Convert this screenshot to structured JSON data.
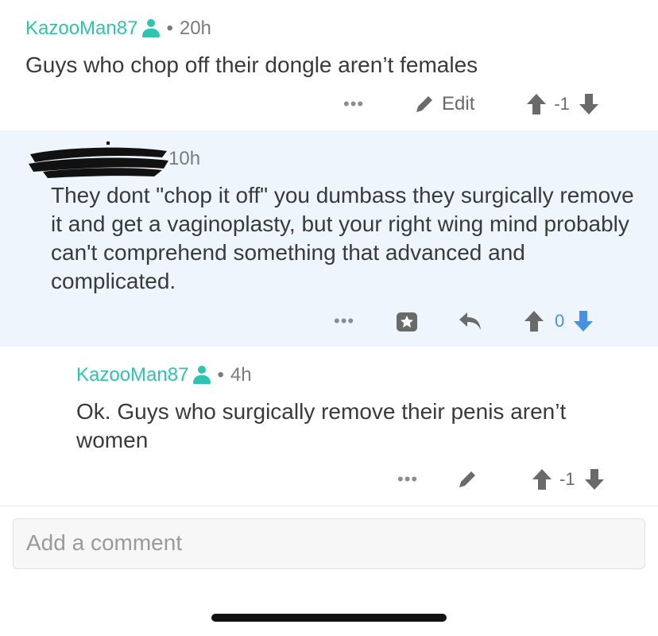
{
  "comments": [
    {
      "username": "KazooMan87",
      "time": "20h",
      "text": "Guys who chop off their dongle aren’t females",
      "more": "•••",
      "edit_label": "Edit",
      "score": "-1",
      "user_icon": "person-icon"
    },
    {
      "time": "10h",
      "text": "They dont \"chop it off\" you dumbass they surgically remove it and get a vaginoplasty, but your right wing mind probably can't comprehend something that advanced and complicated.",
      "more": "•••",
      "score": "0"
    },
    {
      "username": "KazooMan87",
      "time": "4h",
      "text": "Ok. Guys who surgically remove their penis aren’t women",
      "more": "•••",
      "score": "-1",
      "user_icon": "person-icon"
    }
  ],
  "separator": "•",
  "add_comment": {
    "placeholder": "Add a comment"
  },
  "colors": {
    "username": "#2ec4b0",
    "highlight_bg": "#eef5fc",
    "downvote_active": "#4a90e2",
    "icon_gray": "#6a6a6a"
  }
}
